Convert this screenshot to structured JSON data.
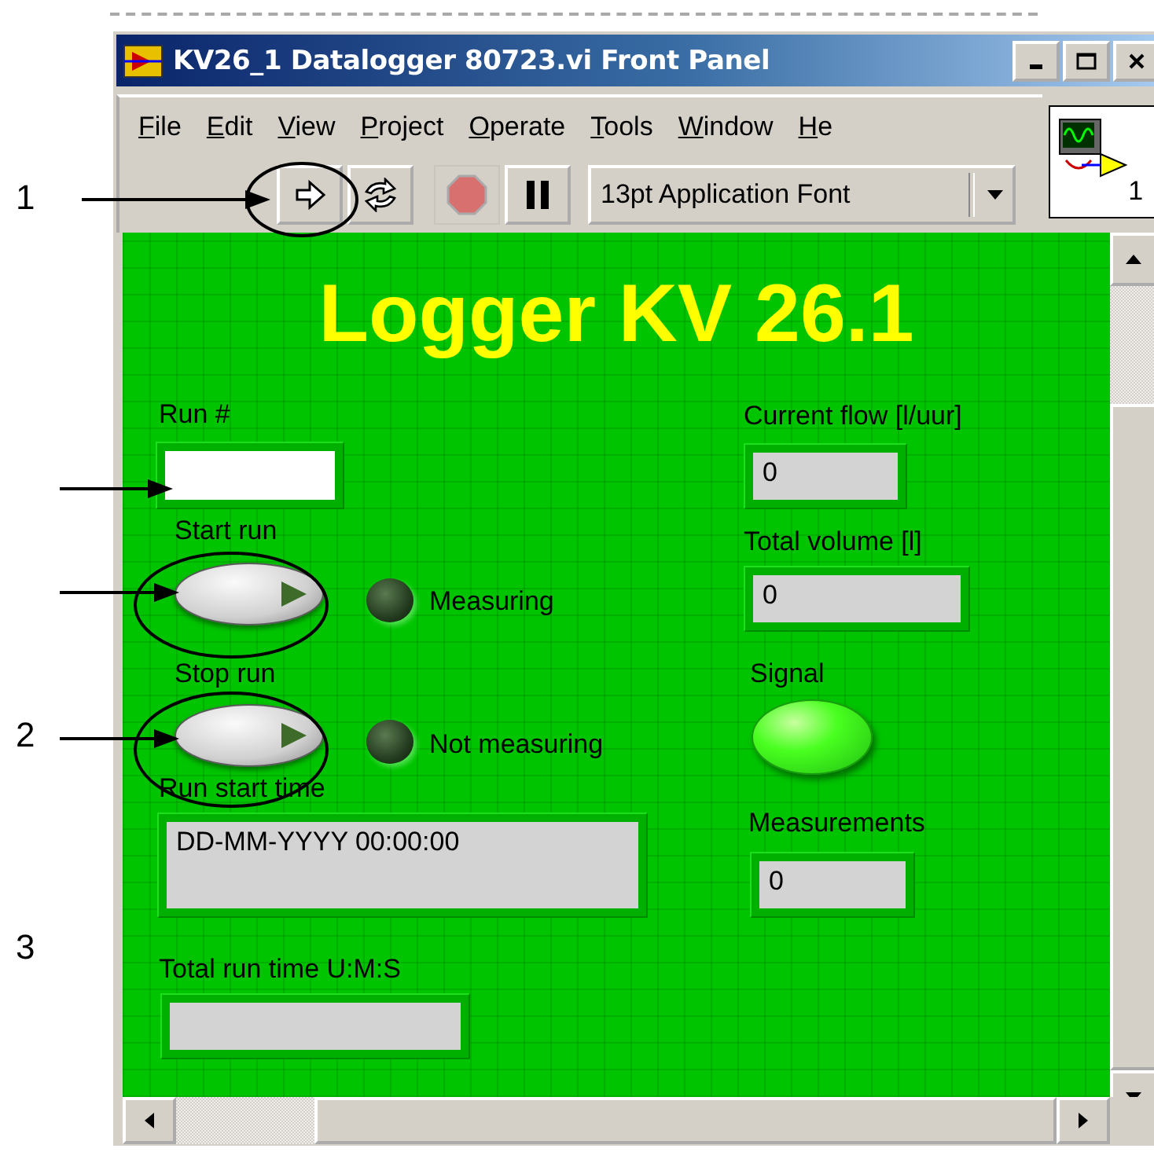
{
  "window": {
    "title": "KV26_1 Datalogger 80723.vi Front Panel"
  },
  "menu": [
    "File",
    "Edit",
    "View",
    "Project",
    "Operate",
    "Tools",
    "Window",
    "He"
  ],
  "toolbar": {
    "font": "13pt Application Font",
    "icon_text": "1"
  },
  "panel": {
    "title": "Logger KV 26.1",
    "controls": [
      {
        "kind": "input",
        "label": "Run #"
      },
      {
        "kind": "button",
        "label": "Start run"
      },
      {
        "kind": "led",
        "label": "Measuring",
        "on": false
      },
      {
        "kind": "button",
        "label": "Stop run"
      },
      {
        "kind": "led",
        "label": "Not measuring",
        "on": false
      },
      {
        "kind": "display",
        "label": "Run start time",
        "value": "DD-MM-YYYY 00:00:00"
      },
      {
        "kind": "display",
        "label": "Total run time U:M:S"
      },
      {
        "kind": "display",
        "label": "Current flow [l/uur]",
        "value": "0"
      },
      {
        "kind": "display",
        "label": "Total volume [l]",
        "value": "0"
      },
      {
        "kind": "led",
        "label": "Signal",
        "on": true
      },
      {
        "kind": "display",
        "label": "Measurements",
        "value": "0"
      }
    ]
  },
  "annotations": [
    "1",
    "2",
    "3"
  ]
}
